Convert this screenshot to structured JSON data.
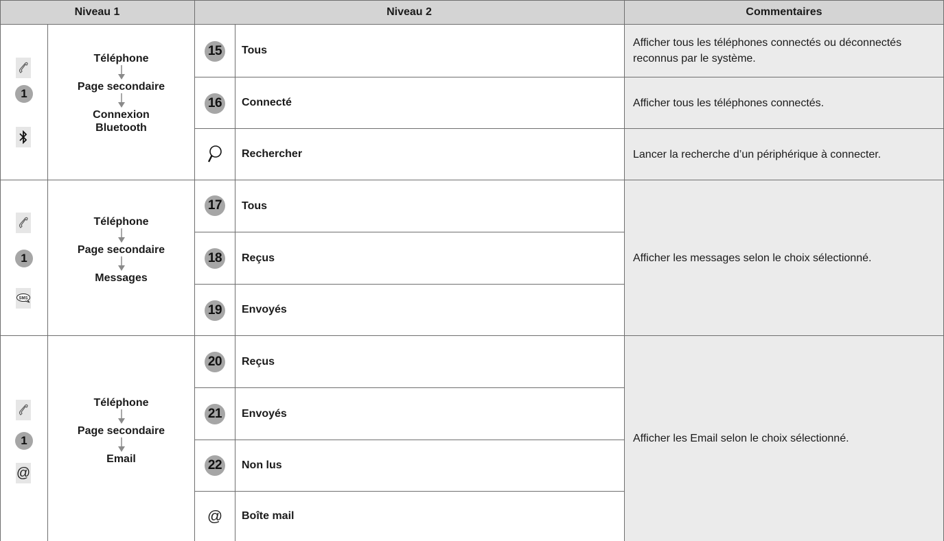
{
  "header": {
    "col1": "Niveau 1",
    "col2": "Niveau 2",
    "col3": "Commentaires"
  },
  "sections": [
    {
      "level1_path": [
        "Téléphone",
        "Page secondaire",
        "Connexion Bluetooth"
      ],
      "icons": [
        "phone-icon",
        "1",
        "bluetooth-icon"
      ],
      "options": [
        {
          "marker": "15",
          "label": "Tous"
        },
        {
          "marker": "16",
          "label": "Connecté"
        },
        {
          "marker": "search-icon",
          "label": "Rechercher"
        }
      ],
      "comments": [
        "Afficher tous les téléphones connectés ou déconnectés reconnus par le système.",
        "Afficher tous les téléphones connectés.",
        "Lancer la recherche d’un périphérique à connecter."
      ]
    },
    {
      "level1_path": [
        "Téléphone",
        "Page secondaire",
        "Messages"
      ],
      "icons": [
        "phone-icon",
        "1",
        "sms-icon"
      ],
      "options": [
        {
          "marker": "17",
          "label": "Tous"
        },
        {
          "marker": "18",
          "label": "Reçus"
        },
        {
          "marker": "19",
          "label": "Envoyés"
        }
      ],
      "comment": "Afficher les messages selon le choix sélectionné."
    },
    {
      "level1_path": [
        "Téléphone",
        "Page secondaire",
        "Email"
      ],
      "icons": [
        "phone-icon",
        "1",
        "at-icon"
      ],
      "options": [
        {
          "marker": "20",
          "label": "Reçus"
        },
        {
          "marker": "21",
          "label": "Envoyés"
        },
        {
          "marker": "22",
          "label": "Non lus"
        },
        {
          "marker": "@",
          "label": "Boîte mail"
        }
      ],
      "comment": "Afficher les Email selon le choix sélectionné."
    }
  ],
  "colors": {
    "header_bg": "#d4d4d4",
    "comment_bg": "#ebebeb",
    "circle": "#a6a6a6",
    "rule": "#6e6e6e"
  }
}
